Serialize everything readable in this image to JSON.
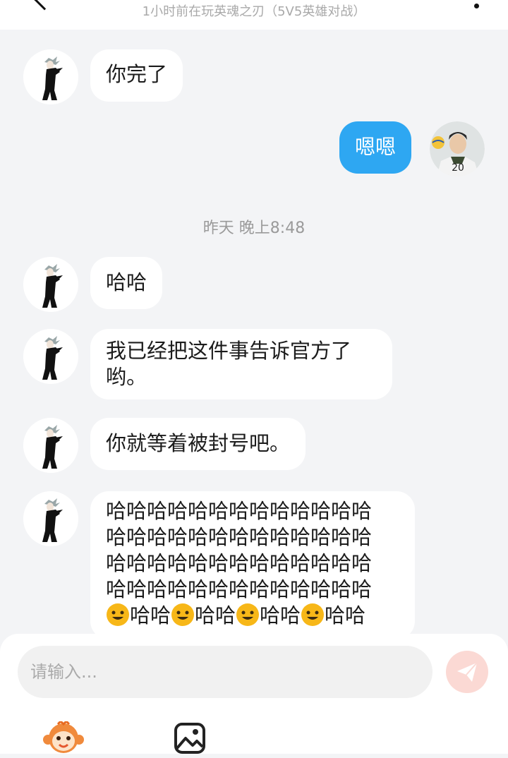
{
  "header": {
    "status_text": "1小时前在玩英魂之刃（5V5英雄对战）"
  },
  "messages": [
    {
      "text": "你完了"
    },
    {
      "text": "嗯嗯"
    },
    {
      "text": "哈哈"
    },
    {
      "text": "我已经把这件事告诉官方了哟。"
    },
    {
      "text": "你就等着被封号吧。"
    },
    {
      "lines": [
        "哈哈哈哈哈哈哈哈哈哈哈哈哈",
        "哈哈哈哈哈哈哈哈哈哈哈哈哈",
        "哈哈哈哈哈哈哈哈哈哈哈哈哈",
        "哈哈哈哈哈哈哈哈哈哈哈哈哈"
      ],
      "last_line": {
        "segments": [
          "哈哈",
          "哈哈",
          "哈哈",
          "哈哈"
        ],
        "emoji": "smile-emoji"
      }
    }
  ],
  "timestamp": "昨天 晚上8:48",
  "self_avatar": {
    "jersey_number": "20"
  },
  "input": {
    "placeholder": "请输入..."
  },
  "colors": {
    "self_bubble": "#2ea7f2",
    "send_button": "#fbd9d4",
    "background": "#f3f4f6"
  }
}
